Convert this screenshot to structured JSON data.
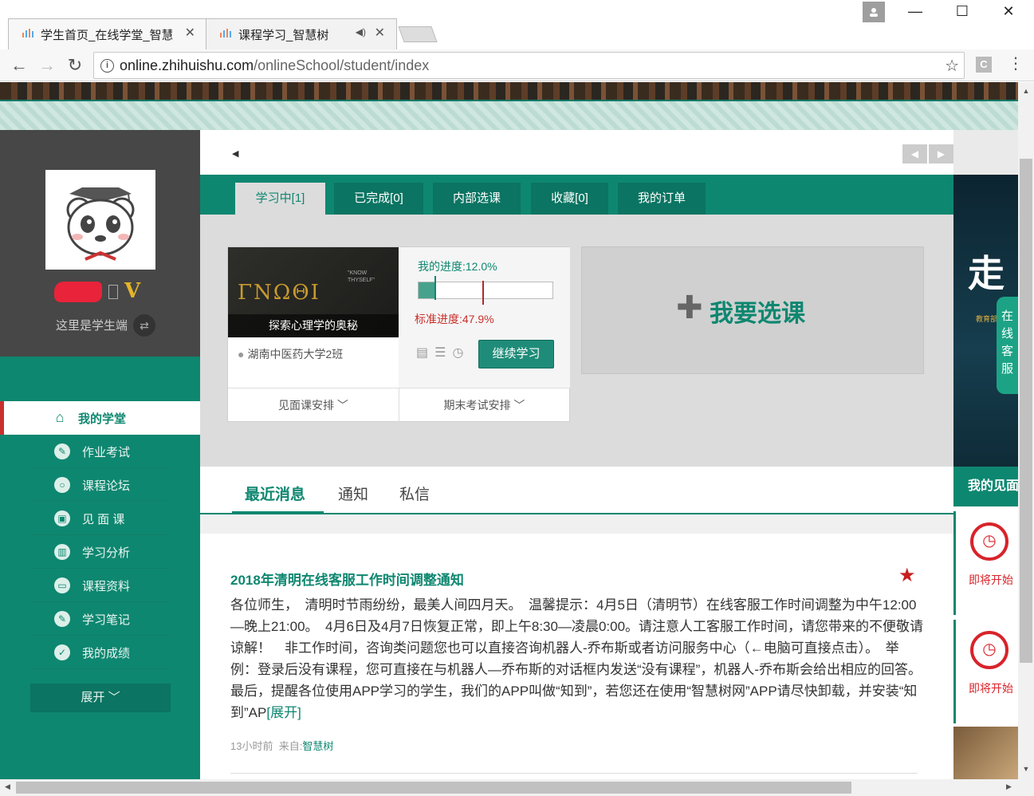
{
  "browser": {
    "tabs": [
      {
        "title": "学生首页_在线学堂_智慧",
        "close": "✕"
      },
      {
        "title": "课程学习_智慧树",
        "close": "✕",
        "sound": "◀)"
      }
    ],
    "url_host": "online.zhihuishu.com",
    "url_path": "/onlineSchool/student/index",
    "nav": {
      "back": "←",
      "forward": "→",
      "reload": "↻"
    },
    "window": {
      "minimize": "—",
      "maximize": "☐",
      "close": "✕"
    },
    "star": "☆",
    "ext": "C",
    "menu": "⋮"
  },
  "profile": {
    "vip_mark": "V",
    "role_text": "这里是学生端"
  },
  "sidebar": {
    "items": [
      {
        "label": "我的学堂",
        "icon": "home-icon",
        "glyph": "⌂"
      },
      {
        "label": "作业考试",
        "icon": "pen-icon",
        "glyph": "✎"
      },
      {
        "label": "课程论坛",
        "icon": "chat-icon",
        "glyph": "○"
      },
      {
        "label": "见 面 课",
        "icon": "screen-icon",
        "glyph": "▣"
      },
      {
        "label": "学习分析",
        "icon": "chart-icon",
        "glyph": "▥"
      },
      {
        "label": "课程资料",
        "icon": "folder-icon",
        "glyph": "▭"
      },
      {
        "label": "学习笔记",
        "icon": "note-icon",
        "glyph": "✎"
      },
      {
        "label": "我的成绩",
        "icon": "check-icon",
        "glyph": "✓"
      }
    ],
    "expand_label": "展开 ﹀"
  },
  "notice": {
    "speaker": "◀",
    "prev": "◀",
    "next": "▶"
  },
  "course_tabs": [
    "学习中[1]",
    "已完成[0]",
    "内部选课",
    "收藏[0]",
    "我的订单"
  ],
  "course": {
    "thumb_greek": "ΓΝΩΘΙ",
    "thumb_know": "\"KNOW\nTHYSELF\"",
    "name": "探索心理学的奥秘",
    "class": "湖南中医药大学2班",
    "my_progress_label": "我的进度:12.0%",
    "my_progress": 0.12,
    "std_progress_label": "标准进度:47.9%",
    "std_progress": 0.479,
    "continue_label": "继续学习",
    "mini_icons": "▤☰◷",
    "foot_left": "见面课安排 ﹀",
    "foot_right": "期末考试安排 ﹀"
  },
  "choose_course": {
    "plus": "✚",
    "label": "我要选课"
  },
  "messages": {
    "tabs": [
      "最近消息",
      "通知",
      "私信"
    ],
    "title": "2018年清明在线客服工作时间调整通知",
    "star": "★",
    "body": "各位师生，　清明时节雨纷纷，最美人间四月天。　温馨提示：4月5日（清明节）在线客服工作时间调整为中午12:00—晚上21:00。　4月6日及4月7日恢复正常，即上午8:30—凌晨0:00。请注意人工客服工作时间，请您带来的不便敬请谅解！　非工作时间，咨询类问题您也可以直接咨询机器人-乔布斯或者访问服务中心（←电脑可直接点击）。　举例：登录后没有课程，您可直接在与机器人—乔布斯的对话框内发送“没有课程”，机器人-乔布斯会给出相应的回答。　最后，提醒各位使用APP学习的学生，我们的APP叫做“知到”，若您还在使用“智慧树网”APP请尽快卸载，并安装“知到”AP",
    "expand": "[展开]",
    "time": "13小时前",
    "from_label": "来自:",
    "from": "智慧树"
  },
  "right": {
    "ad_char": "走",
    "ad_sub": "教育部委托",
    "service": "在线客服",
    "header": "我的见面",
    "alarm_glyph": "◷",
    "alarm_text": "即将开始"
  },
  "colors": {
    "brand": "#0e8770",
    "alert": "#c9302c"
  }
}
